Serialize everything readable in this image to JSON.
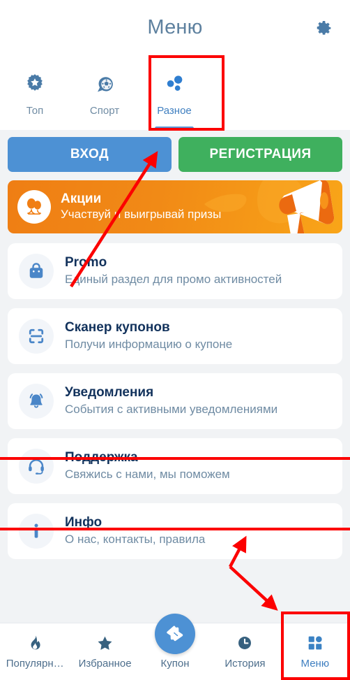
{
  "header": {
    "title": "Меню",
    "settings_icon": "gear-icon"
  },
  "tabs": [
    {
      "label": "Топ",
      "icon": "gear-star-icon",
      "active": false
    },
    {
      "label": "Спорт",
      "icon": "soccer-ball-icon",
      "active": false
    },
    {
      "label": "Разное",
      "icon": "dots-cluster-icon",
      "active": true
    }
  ],
  "auth": {
    "login_label": "ВХОД",
    "register_label": "РЕГИСТРАЦИЯ",
    "login_color": "#4d91d4",
    "register_color": "#3fb05e"
  },
  "promo_banner": {
    "title": "Акции",
    "subtitle": "Участвуй и выигрывай призы",
    "icon": "balloons-icon",
    "art": "megaphone-icon",
    "color_start": "#ef7e14",
    "color_end": "#f9a518"
  },
  "menu_items": [
    {
      "title": "Promo",
      "subtitle": "Единый раздел для промо активностей",
      "icon": "shopping-bag-icon"
    },
    {
      "title": "Сканер купонов",
      "subtitle": "Получи информацию о купоне",
      "icon": "qr-scanner-icon"
    },
    {
      "title": "Уведомления",
      "subtitle": "События с активными уведомлениями",
      "icon": "bell-icon"
    },
    {
      "title": "Поддержка",
      "subtitle": "Свяжись с нами, мы поможем",
      "icon": "headset-icon"
    },
    {
      "title": "Инфо",
      "subtitle": "О нас, контакты, правила",
      "icon": "info-icon"
    }
  ],
  "bottom_nav": [
    {
      "label": "Популярн…",
      "icon": "fire-icon",
      "active": false
    },
    {
      "label": "Избранное",
      "icon": "star-icon",
      "active": false
    },
    {
      "label": "Купон",
      "icon": "ticket-icon",
      "active": false
    },
    {
      "label": "История",
      "icon": "clock-icon",
      "active": false
    },
    {
      "label": "Меню",
      "icon": "grid-icon",
      "active": true
    }
  ],
  "theme": {
    "accent_blue": "#3f7fc0",
    "icon_blue": "#4a86c8",
    "title_navy": "#12325c",
    "muted_blue": "#6f8ba3",
    "page_bg": "#f1f3f5",
    "annotation_red": "#fc0000"
  }
}
